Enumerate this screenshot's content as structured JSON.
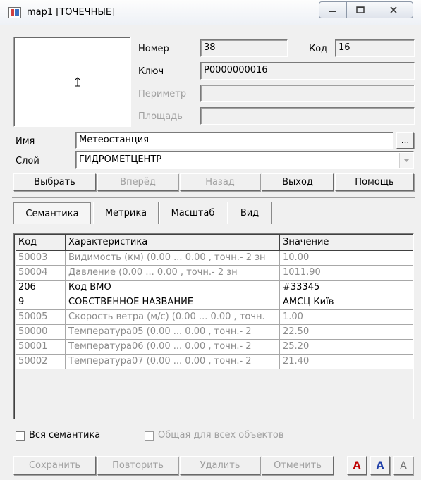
{
  "window": {
    "title": "map1 [ТОЧЕЧНЫЕ]"
  },
  "object": {
    "number_label": "Номер",
    "number_value": "38",
    "code_label": "Код",
    "code_value": "16",
    "key_label": "Ключ",
    "key_value": "P0000000016",
    "perimeter_label": "Периметр",
    "perimeter_value": "",
    "area_label": "Площадь",
    "area_value": "",
    "name_label": "Имя",
    "name_value": "Метеостанция",
    "browse_label": "...",
    "layer_label": "Слой",
    "layer_value": "ГИДРОМЕТЦЕНТР"
  },
  "nav": {
    "select": "Выбрать",
    "forward": "Вперёд",
    "back": "Назад",
    "exit": "Выход",
    "help": "Помощь"
  },
  "tabs": [
    "Семантика",
    "Метрика",
    "Масштаб",
    "Вид"
  ],
  "table": {
    "columns": [
      "Код",
      "Характеристика",
      "Значение"
    ],
    "rows": [
      [
        "50003",
        "Видимость (км)  (0.00 ... 0.00 , точн.- 2  зн",
        "10.00"
      ],
      [
        "50004",
        "Давление  (0.00 ... 0.00 , точн.- 2  зн",
        "1011.90"
      ],
      [
        "206",
        "Код ВМО",
        "#33345"
      ],
      [
        "9",
        "СОБСТВЕННОЕ НАЗВАНИЕ",
        "АМСЦ Київ"
      ],
      [
        "50005",
        "Скорость ветра  (м/с)  (0.00 ... 0.00 , точн.",
        "1.00"
      ],
      [
        "50000",
        "Температура05  (0.00 ... 0.00 , точн.- 2",
        "22.50"
      ],
      [
        "50001",
        "Температура06  (0.00 ... 0.00 , точн.- 2",
        "25.20"
      ],
      [
        "50002",
        "Температура07  (0.00 ... 0.00 , точн.- 2",
        "21.40"
      ]
    ],
    "disabled_rows": [
      true,
      true,
      false,
      false,
      true,
      true,
      true,
      true
    ]
  },
  "options": {
    "all_semantics": "Вся семантика",
    "common_for_all": "Общая для всех объектов"
  },
  "actions": {
    "save": "Сохранить",
    "repeat": "Повторить",
    "delete": "Удалить",
    "cancel": "Отменить",
    "font1": "A",
    "font2": "A",
    "font3": "A"
  },
  "colors": {
    "font_btn1": "#c00000",
    "font_btn2": "#1f3fa8",
    "font_btn3": "#707070"
  }
}
